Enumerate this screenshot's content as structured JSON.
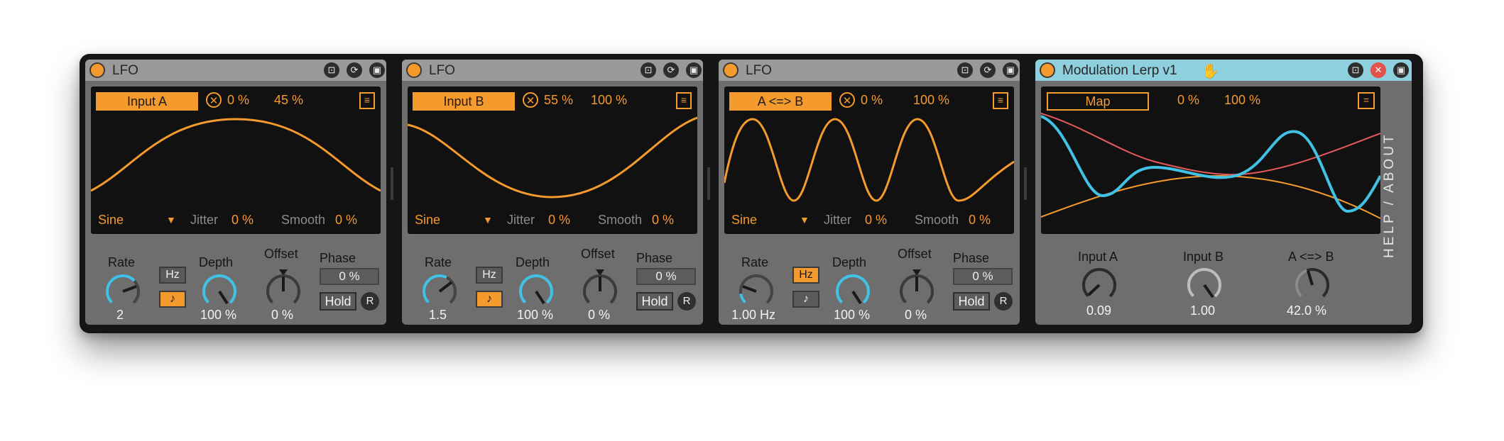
{
  "colors": {
    "accent": "#f59a2c",
    "cyan": "#41c1e3",
    "red": "#e85a5a",
    "device_bg": "#6e6e6e",
    "display_bg": "#111111"
  },
  "lfos": [
    {
      "title": "LFO",
      "target": "Input A",
      "min": "0 %",
      "max": "45 %",
      "waveform": "Sine",
      "jitter_label": "Jitter",
      "jitter": "0 %",
      "smooth_label": "Smooth",
      "smooth": "0 %",
      "rate_label": "Rate",
      "rate_value": "2",
      "hz_label": "Hz",
      "sync_label": "♪",
      "rate_mode": "sync",
      "depth_label": "Depth",
      "depth_value": "100 %",
      "offset_label": "Offset",
      "offset_value": "0 %",
      "phase_label": "Phase",
      "phase_value": "0 %",
      "hold_label": "Hold",
      "r_label": "R"
    },
    {
      "title": "LFO",
      "target": "Input B",
      "min": "55 %",
      "max": "100 %",
      "waveform": "Sine",
      "jitter_label": "Jitter",
      "jitter": "0 %",
      "smooth_label": "Smooth",
      "smooth": "0 %",
      "rate_label": "Rate",
      "rate_value": "1.5",
      "hz_label": "Hz",
      "sync_label": "♪",
      "rate_mode": "sync",
      "depth_label": "Depth",
      "depth_value": "100 %",
      "offset_label": "Offset",
      "offset_value": "0 %",
      "phase_label": "Phase",
      "phase_value": "0 %",
      "hold_label": "Hold",
      "r_label": "R"
    },
    {
      "title": "LFO",
      "target": "A <=> B",
      "min": "0 %",
      "max": "100 %",
      "waveform": "Sine",
      "jitter_label": "Jitter",
      "jitter": "0 %",
      "smooth_label": "Smooth",
      "smooth": "0 %",
      "rate_label": "Rate",
      "rate_value": "1.00 Hz",
      "hz_label": "Hz",
      "sync_label": "♪",
      "rate_mode": "hz",
      "depth_label": "Depth",
      "depth_value": "100 %",
      "offset_label": "Offset",
      "offset_value": "0 %",
      "phase_label": "Phase",
      "phase_value": "0 %",
      "hold_label": "Hold",
      "r_label": "R"
    }
  ],
  "lerp": {
    "title": "Modulation Lerp v1",
    "map_label": "Map",
    "min": "0 %",
    "max": "100 %",
    "menu_glyph": "=",
    "side_label": "HELP / ABOUT",
    "knobs": [
      {
        "label": "Input A",
        "value": "0.09"
      },
      {
        "label": "Input B",
        "value": "1.00"
      },
      {
        "label": "A <=> B",
        "value": "42.0 %"
      }
    ]
  },
  "icons": {
    "map": "map-icon",
    "hotswap": "hotswap-icon",
    "save": "save-icon",
    "close": "close-icon",
    "hand": "hand-icon",
    "x": "unmap-x-icon",
    "menu": "menu-icon",
    "dropdown": "dropdown-triangle-icon"
  }
}
